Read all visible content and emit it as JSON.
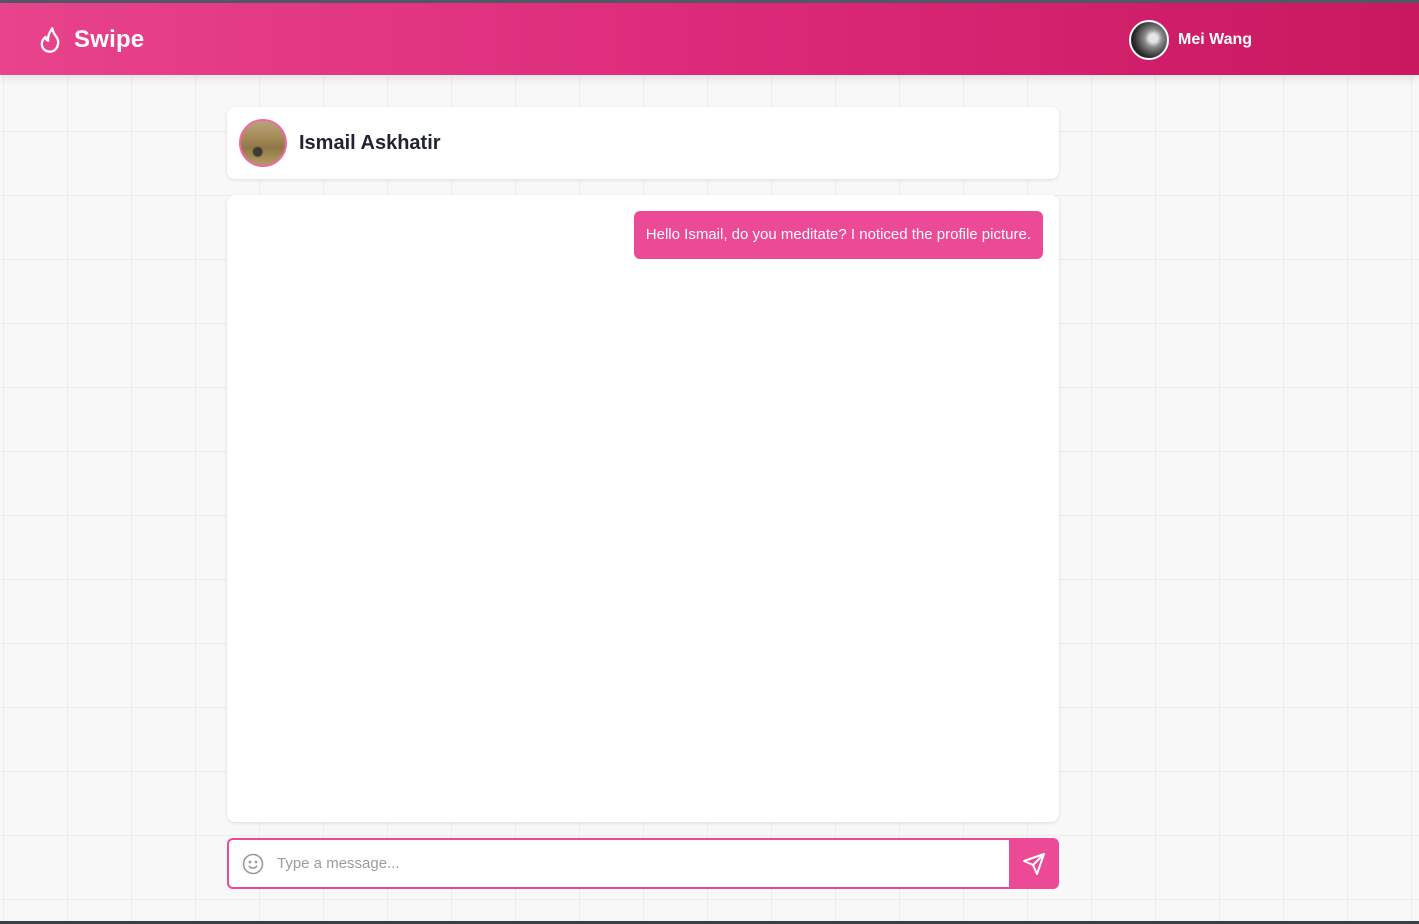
{
  "app": {
    "brand": "Swipe",
    "brand_icon": "flame-icon"
  },
  "user": {
    "name": "Mei Wang"
  },
  "chat": {
    "contact_name": "Ismail Askhatir",
    "messages": [
      {
        "from": "me",
        "text": "Hello Ismail, do you meditate? I noticed the profile picture."
      }
    ]
  },
  "composer": {
    "placeholder": "Type a message...",
    "value": "",
    "emoji_icon": "smiley-icon",
    "send_icon": "send-icon"
  },
  "colors": {
    "accent": "#ec4a96",
    "header_start": "#e8438c",
    "header_end": "#c8185f",
    "background": "#f8f8f8"
  }
}
